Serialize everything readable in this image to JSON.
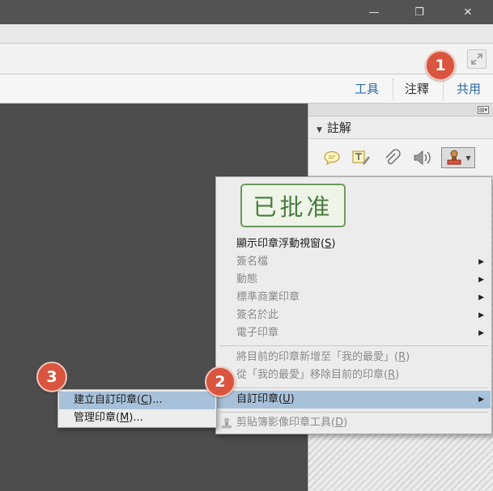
{
  "window": {
    "minimize_glyph": "—",
    "restore_glyph": "❐",
    "close_glyph": "✕"
  },
  "tabs": [
    {
      "label": "工具"
    },
    {
      "label": "注釋"
    },
    {
      "label": "共用"
    }
  ],
  "pane": {
    "header": "註解",
    "options_glyph": "▤▾"
  },
  "annotation_tools": [
    "sticky-note-icon",
    "text-edit-icon",
    "attach-file-icon",
    "record-audio-icon",
    "stamp-icon"
  ],
  "stamp_preview": "已批准",
  "context_menu": {
    "items": [
      {
        "label": "顯示印章浮動視窗(",
        "key": "S",
        "suffix": ")",
        "disabled": false,
        "submenu": false
      },
      {
        "label": "簽名檔",
        "disabled": true,
        "submenu": true
      },
      {
        "label": "動態",
        "disabled": true,
        "submenu": true
      },
      {
        "label": "標準商業印章",
        "disabled": true,
        "submenu": true
      },
      {
        "label": "簽名於此",
        "disabled": true,
        "submenu": true
      },
      {
        "label": "電子印章",
        "disabled": true,
        "submenu": true
      },
      {
        "label": "將目前的印章新增至「我的最愛」(",
        "key": "R",
        "suffix": ")",
        "disabled": true
      },
      {
        "label": "從「我的最愛」移除目前的印章(",
        "key": "R",
        "suffix": ")",
        "disabled": true
      },
      {
        "label": "自訂印章(",
        "key": "U",
        "suffix": ")",
        "disabled": false,
        "submenu": true,
        "highlighted": true
      },
      {
        "label": "剪貼簿影像印章工具(",
        "key": "D",
        "suffix": ")",
        "disabled": true
      }
    ]
  },
  "submenu": {
    "items": [
      {
        "label": "建立自訂印章(",
        "key": "C",
        "suffix": ")...",
        "highlighted": true
      },
      {
        "label": "管理印章(",
        "key": "M",
        "suffix": ")..."
      }
    ]
  },
  "callouts": [
    "1",
    "2",
    "3"
  ],
  "colors": {
    "callout": "#d9553f",
    "tab_link": "#2d6aa6",
    "highlight": "#a8c1da",
    "stamp_green": "#4b7c41"
  }
}
